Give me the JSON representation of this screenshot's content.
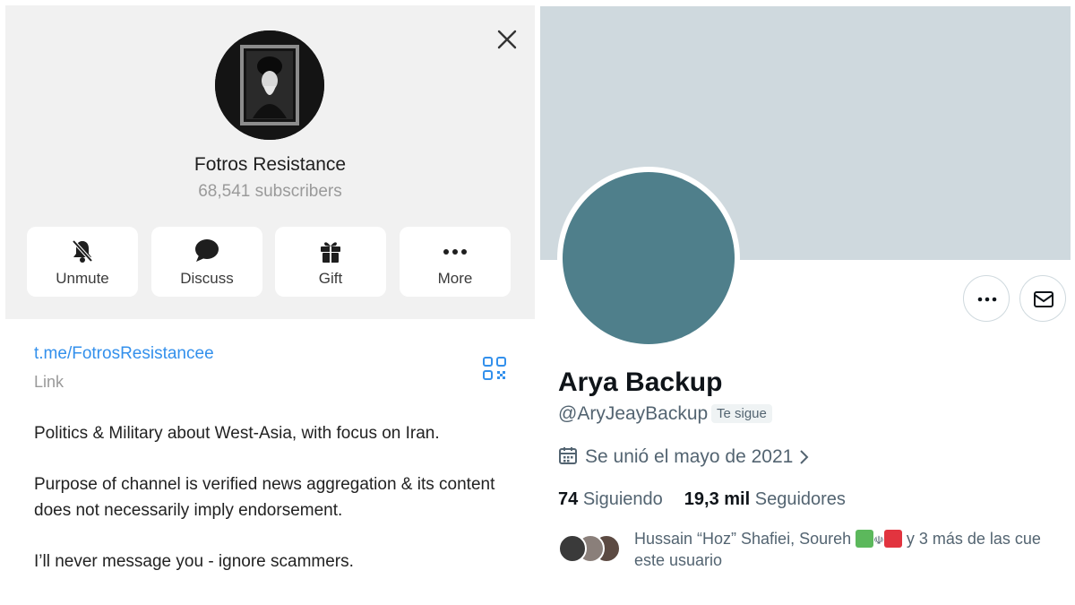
{
  "telegram": {
    "channel_name": "Fotros Resistance",
    "subscribers": "68,541 subscribers",
    "actions": [
      {
        "label": "Unmute",
        "icon": "bell-off-icon"
      },
      {
        "label": "Discuss",
        "icon": "chat-bubble-icon"
      },
      {
        "label": "Gift",
        "icon": "gift-icon"
      },
      {
        "label": "More",
        "icon": "more-dots-icon"
      }
    ],
    "link": "t.me/FotrosResistancee",
    "link_label": "Link",
    "description": [
      "Politics & Military about West-Asia, with focus on Iran.",
      "Purpose of channel is verified news aggregation & its content does not necessarily imply endorsement.",
      "I’ll never message you - ignore scammers."
    ],
    "colors": {
      "link": "#3390ec",
      "header_bg": "#f1f1f1"
    }
  },
  "twitter": {
    "display_name": "Arya Backup",
    "handle": "@AryJeayBackup",
    "follows_you": "Te sigue",
    "joined": "Se unió el mayo de 2021",
    "following_count": "74",
    "following_label": "Siguiendo",
    "followers_count": "19,3 mil",
    "followers_label": "Seguidores",
    "followed_by_names": "Hussain “Hoz” Shafiei, Soureh",
    "followed_by_rest": "y 3 más de las cue",
    "followed_by_line2": "este usuario",
    "colors": {
      "banner": "#cfd9de",
      "avatar": "#4f7f8b",
      "secondary_text": "#536471"
    }
  }
}
